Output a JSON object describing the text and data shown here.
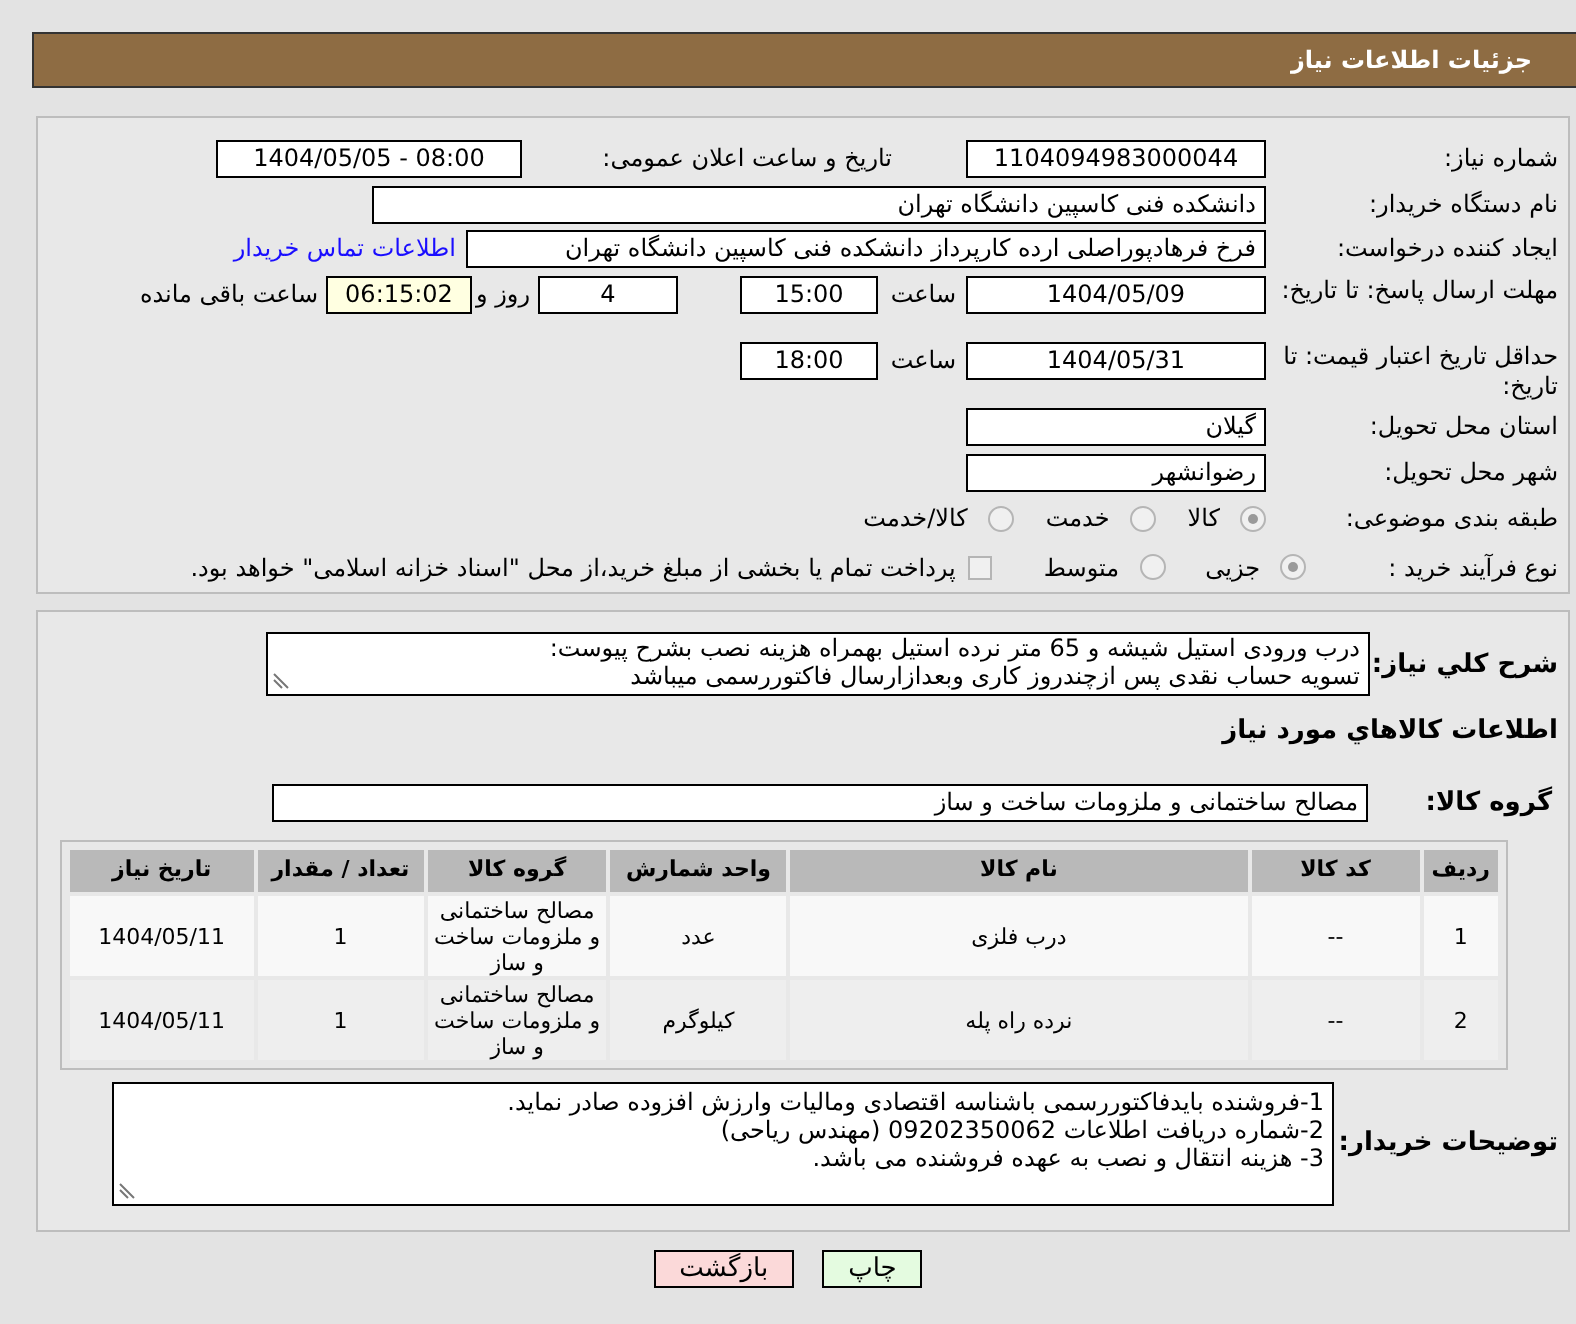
{
  "header": {
    "title": "جزئیات اطلاعات نیاز"
  },
  "need_number": {
    "label": "شماره نیاز:",
    "value": "1104094983000044"
  },
  "announce": {
    "label": "تاریخ و ساعت اعلان عمومی:",
    "value": "1404/05/05 - 08:00"
  },
  "buyer_org": {
    "label": "نام دستگاه خریدار:",
    "value": "دانشکده فنی کاسپین دانشگاه تهران"
  },
  "requester": {
    "label": "ایجاد کننده درخواست:",
    "value": "فرخ فرهادپوراصلی ارده کارپرداز دانشکده فنی کاسپین دانشگاه تهران",
    "link": "اطلاعات تماس خریدار"
  },
  "response_deadline": {
    "label": "مهلت ارسال پاسخ: تا تاریخ:",
    "date": "1404/05/09",
    "time_label": "ساعت",
    "time": "15:00",
    "days": "4",
    "days_label": "روز و",
    "remaining": "06:15:02",
    "remaining_label": "ساعت باقی مانده"
  },
  "price_validity": {
    "label": "حداقل تاریخ اعتبار قیمت: تا تاریخ:",
    "date": "1404/05/31",
    "time_label": "ساعت",
    "time": "18:00"
  },
  "province": {
    "label": "استان محل تحویل:",
    "value": "گیلان"
  },
  "city": {
    "label": "شهر محل تحویل:",
    "value": "رضوانشهر"
  },
  "category": {
    "label": "طبقه بندی موضوعی:",
    "options": [
      {
        "label": "کالا",
        "selected": true
      },
      {
        "label": "خدمت",
        "selected": false
      },
      {
        "label": "کالا/خدمت",
        "selected": false
      }
    ]
  },
  "process": {
    "label": "نوع فرآیند خرید :",
    "options": [
      {
        "label": "جزیی",
        "selected": true
      },
      {
        "label": "متوسط",
        "selected": false
      }
    ],
    "checkbox": {
      "label": "پرداخت تمام یا بخشی از مبلغ خرید،از محل \"اسناد خزانه اسلامی\" خواهد بود.",
      "checked": false
    }
  },
  "description": {
    "label": "شرح کلي نياز:",
    "lines": [
      "درب ورودی استیل شیشه و 65 متر نرده استیل بهمراه هزینه نصب بشرح پیوست:",
      "تسویه حساب نقدی پس ازچندروز کاری وبعدازارسال فاکتوررسمی میباشد"
    ]
  },
  "goods_title": "اطلاعات کالاهاي مورد نياز",
  "goods_group": {
    "label": "گروه کالا:",
    "value": "مصالح ساختمانی و ملزومات ساخت و ساز"
  },
  "table": {
    "columns": [
      "ردیف",
      "کد کالا",
      "نام کالا",
      "واحد شمارش",
      "گروه کالا",
      "تعداد / مقدار",
      "تاریخ نیاز"
    ],
    "rows": [
      [
        "1",
        "--",
        "درب فلزی",
        "عدد",
        "مصالح ساختمانی و ملزومات ساخت و ساز",
        "1",
        "1404/05/11"
      ],
      [
        "2",
        "--",
        "نرده راه پله",
        "کیلوگرم",
        "مصالح ساختمانی و ملزومات ساخت و ساز",
        "1",
        "1404/05/11"
      ]
    ]
  },
  "buyer_notes": {
    "label": "توضیحات خریدار:",
    "lines": [
      "1-فروشنده بایدفاکتوررسمی باشناسه اقتصادی ومالیات وارزش افزوده صادر نماید.",
      "2-شماره دریافت اطلاعات 09202350062 (مهندس ریاحی)",
      "3- هزینه انتقال و نصب به عهده فروشنده می باشد."
    ]
  },
  "buttons": [
    {
      "label": "چاپ",
      "kind": "print"
    },
    {
      "label": "بازگشت",
      "kind": "back"
    }
  ]
}
